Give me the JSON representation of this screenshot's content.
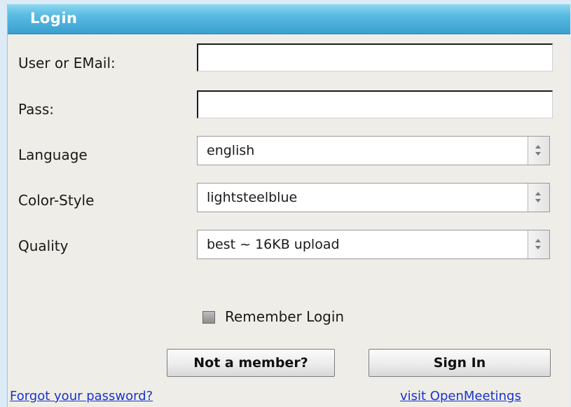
{
  "window": {
    "title": "Login"
  },
  "form": {
    "user_label": "User or EMail:",
    "user_value": "",
    "pass_label": "Pass:",
    "pass_value": "",
    "language_label": "Language",
    "language_value": "english",
    "color_style_label": "Color-Style",
    "color_style_value": "lightsteelblue",
    "quality_label": "Quality",
    "quality_value": "best ~ 16KB upload",
    "remember_label": "Remember Login",
    "remember_checked": false
  },
  "buttons": {
    "not_member": "Not a member?",
    "sign_in": "Sign In"
  },
  "links": {
    "forgot_password": "Forgot your password?",
    "visit_site": "visit OpenMeetings"
  },
  "colors": {
    "titlebar": "#3a9fd0",
    "panel_background": "#eeede7",
    "link": "#1a33cc"
  }
}
